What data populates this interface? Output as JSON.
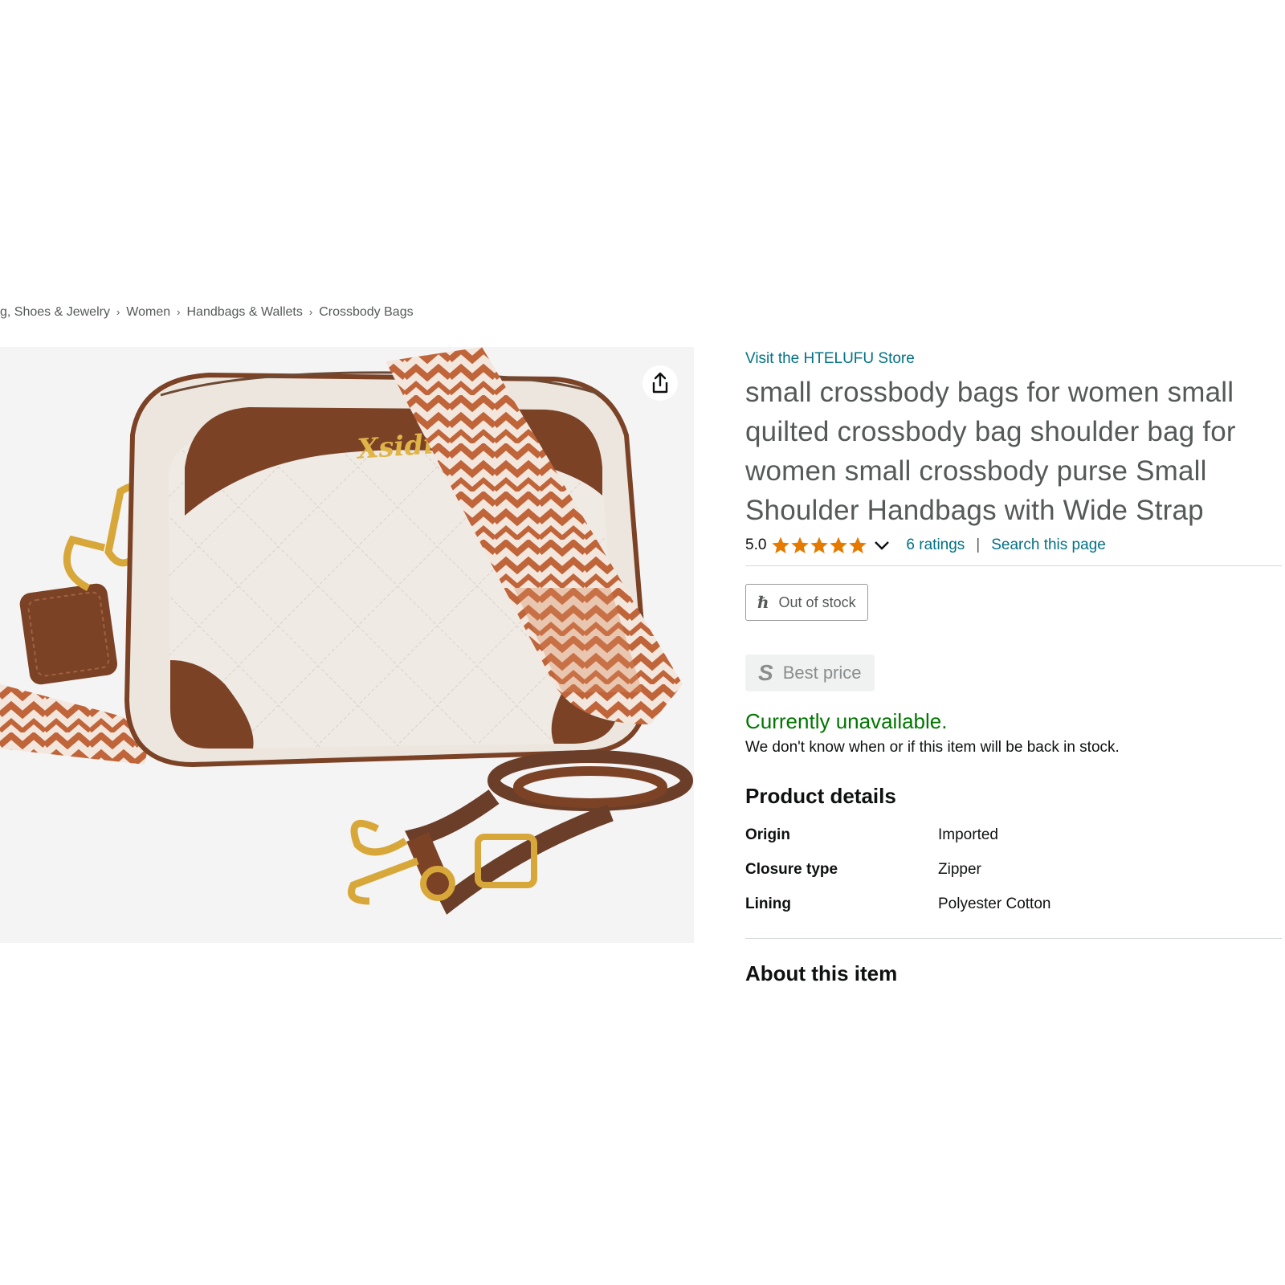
{
  "breadcrumb": {
    "items": [
      "g, Shoes & Jewelry",
      "Women",
      "Handbags & Wallets",
      "Crossbody Bags"
    ]
  },
  "product_image": {
    "brand_logo_text": "Xsidiansha"
  },
  "icons": {
    "share": "share-icon",
    "star": "star-icon",
    "chevron": "chevron-down-icon",
    "price_history": "price-history-icon",
    "best_price": "best-price-icon"
  },
  "store": {
    "link_text": "Visit the HTELUFU Store"
  },
  "product": {
    "title": "small crossbody bags for women small quilted crossbody bag shoulder bag for women small crossbody purse Small Shoulder Handbags with Wide Strap",
    "rating_value": "5.0",
    "star_rating": 5,
    "ratings_link": "6 ratings",
    "divider": "|",
    "search_link": "Search this page"
  },
  "badges": {
    "out_of_stock": "Out of stock",
    "out_of_stock_icon_glyph": "ℏ",
    "best_price": "Best price",
    "best_price_icon_glyph": "S"
  },
  "availability": {
    "status": "Currently unavailable.",
    "note": "We don't know when or if this item will be back in stock."
  },
  "product_details": {
    "heading": "Product details",
    "rows": [
      {
        "label": "Origin",
        "value": "Imported"
      },
      {
        "label": "Closure type",
        "value": "Zipper"
      },
      {
        "label": "Lining",
        "value": "Polyester Cotton"
      }
    ]
  },
  "about": {
    "heading": "About this item"
  },
  "colors": {
    "link": "#007185",
    "in_stock_green": "#007600",
    "star": "#e67a00",
    "text_muted": "#565959",
    "bag_brown": "#7b4226",
    "bag_cream": "#f1ece6"
  }
}
